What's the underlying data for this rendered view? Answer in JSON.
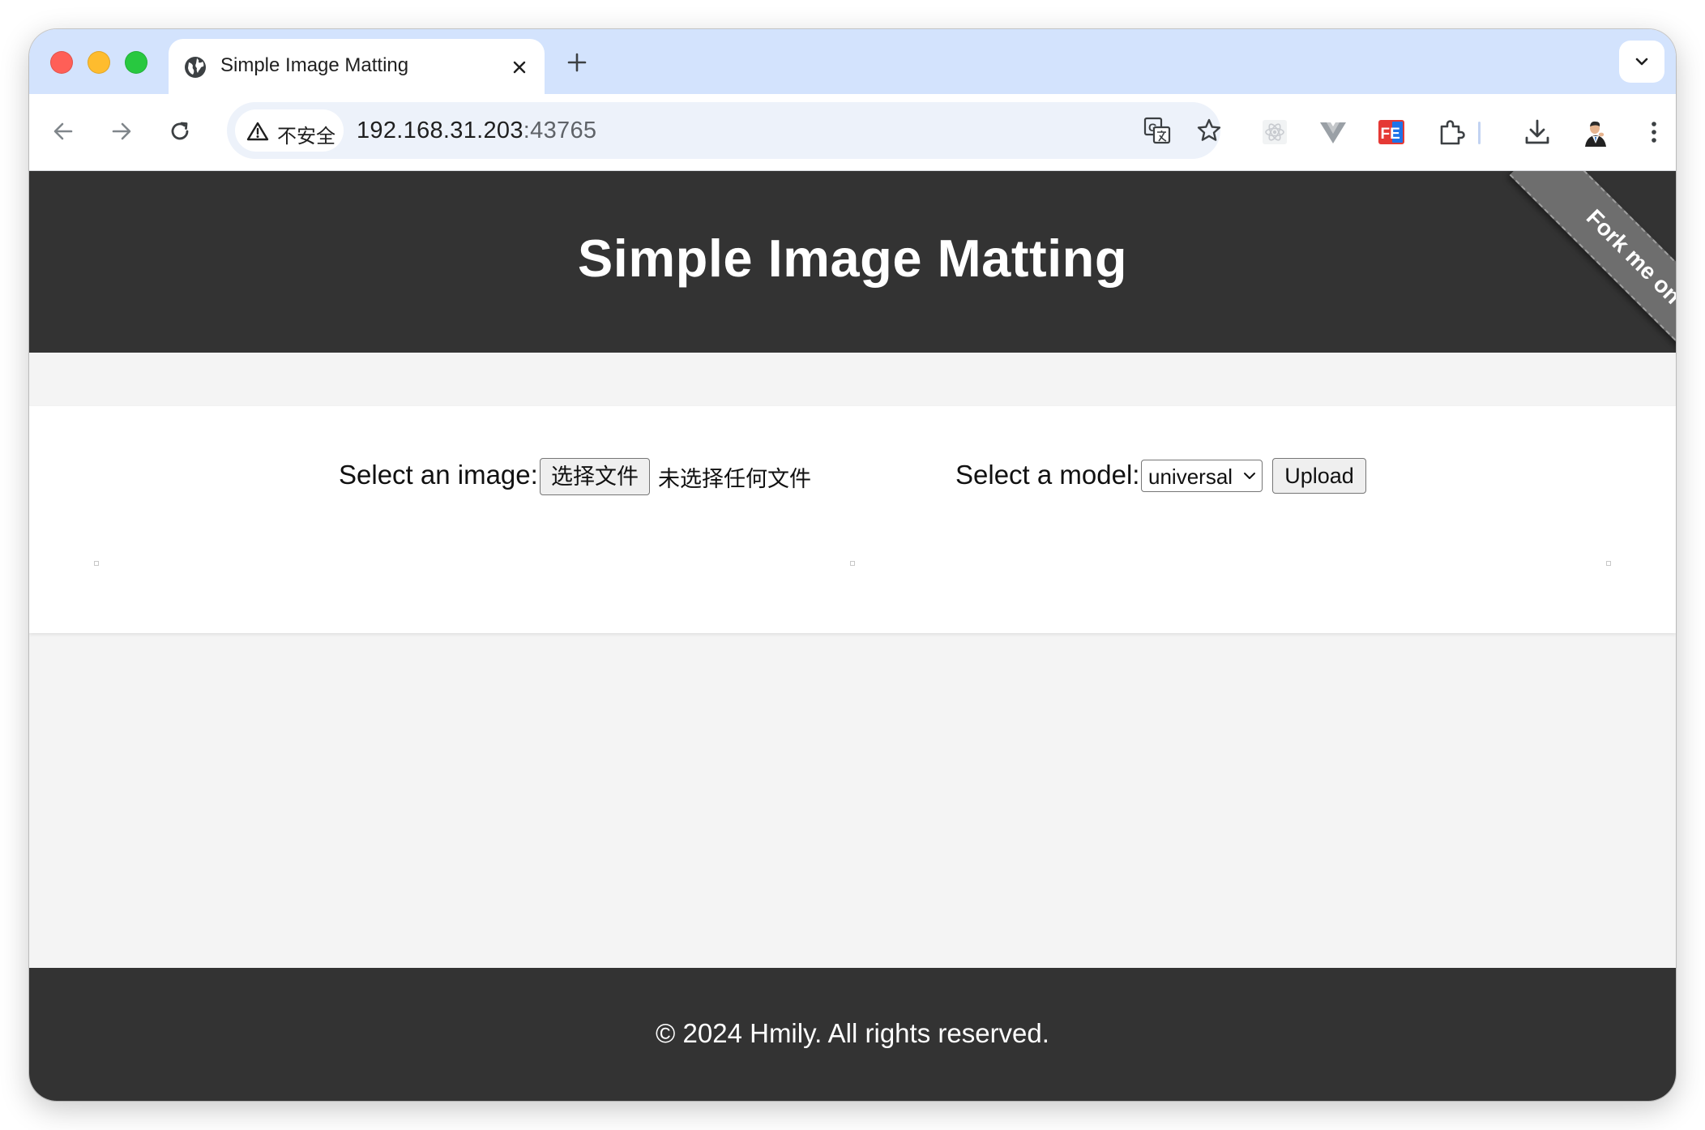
{
  "browser": {
    "tab": {
      "title": "Simple Image Matting"
    },
    "address_bar": {
      "security_label": "不安全",
      "host": "192.168.31.203",
      "port": ":43765"
    },
    "icons": [
      "globe-icon",
      "close-icon",
      "plus-icon",
      "chevron-down-icon",
      "back-icon",
      "forward-icon",
      "reload-icon",
      "warning-icon",
      "translate-icon",
      "star-icon",
      "react-devtools-icon",
      "vue-devtools-icon",
      "fe-helper-icon",
      "extensions-icon",
      "download-icon",
      "avatar",
      "more-icon"
    ]
  },
  "page": {
    "header": {
      "title": "Simple Image Matting",
      "ribbon": "Fork me on GitHub"
    },
    "form": {
      "image_label": "Select an image:",
      "file_button": "选择文件",
      "file_status": "未选择任何文件",
      "model_label": "Select a model:",
      "model_selected": "universal",
      "upload_button": "Upload"
    },
    "footer": {
      "text": "© 2024 Hmily. All rights reserved."
    }
  },
  "colors": {
    "tab_strip": "#d3e3fd",
    "header_bg": "#333333",
    "page_bg": "#f4f4f4",
    "ribbon_bg": "#6e6e6e"
  }
}
